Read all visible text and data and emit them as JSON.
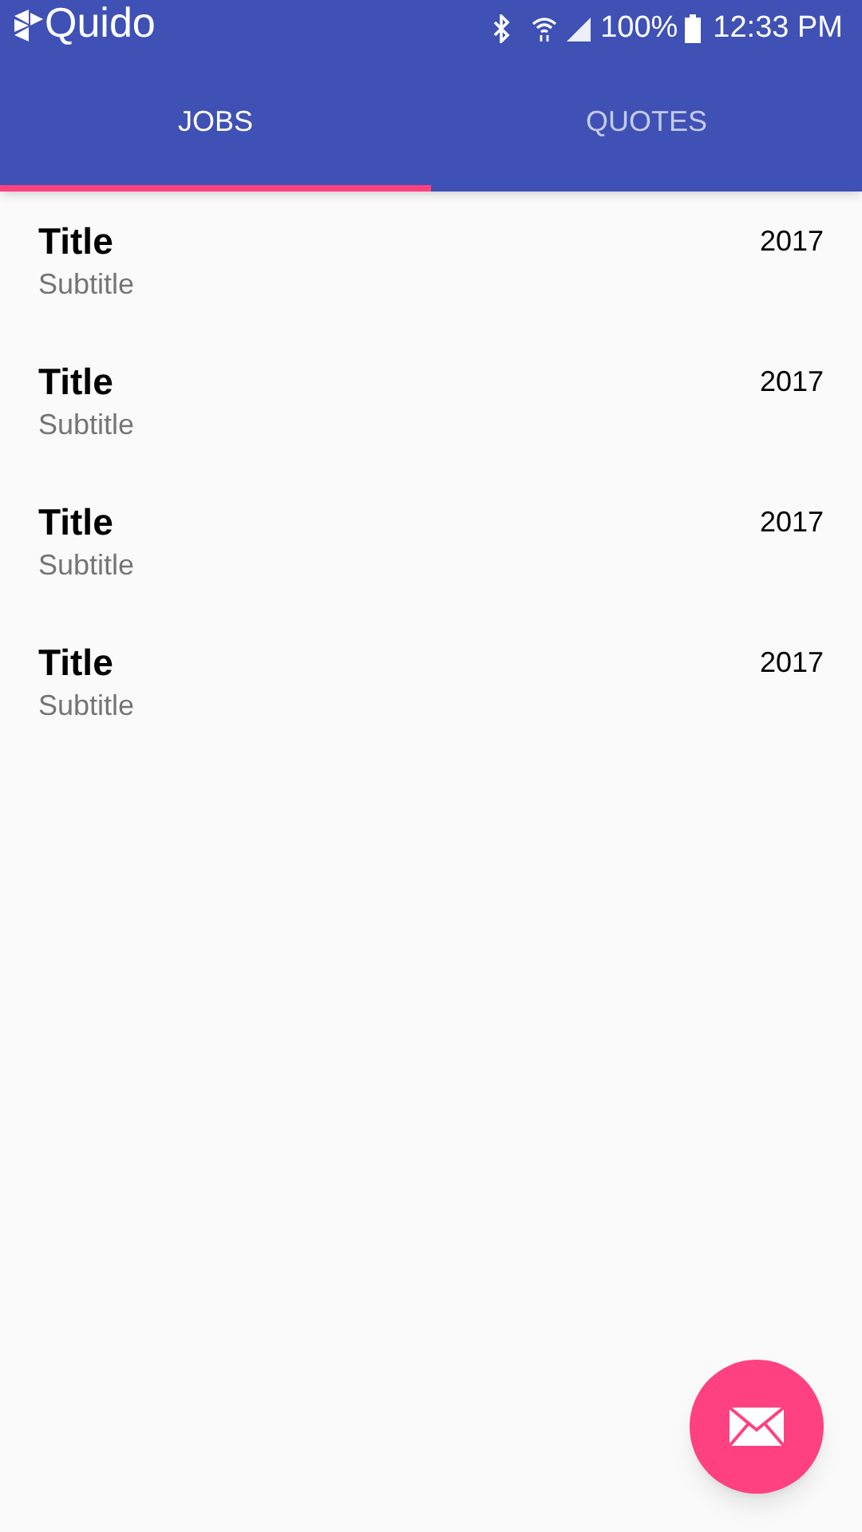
{
  "app": {
    "title": "Quido"
  },
  "status_bar": {
    "battery": "100%",
    "time": "12:33 PM"
  },
  "tabs": [
    {
      "label": "JOBS",
      "selected": true
    },
    {
      "label": "QUOTES",
      "selected": false
    }
  ],
  "items": [
    {
      "title": "Title",
      "subtitle": "Subtitle",
      "date": "2017"
    },
    {
      "title": "Title",
      "subtitle": "Subtitle",
      "date": "2017"
    },
    {
      "title": "Title",
      "subtitle": "Subtitle",
      "date": "2017"
    },
    {
      "title": "Title",
      "subtitle": "Subtitle",
      "date": "2017"
    }
  ]
}
